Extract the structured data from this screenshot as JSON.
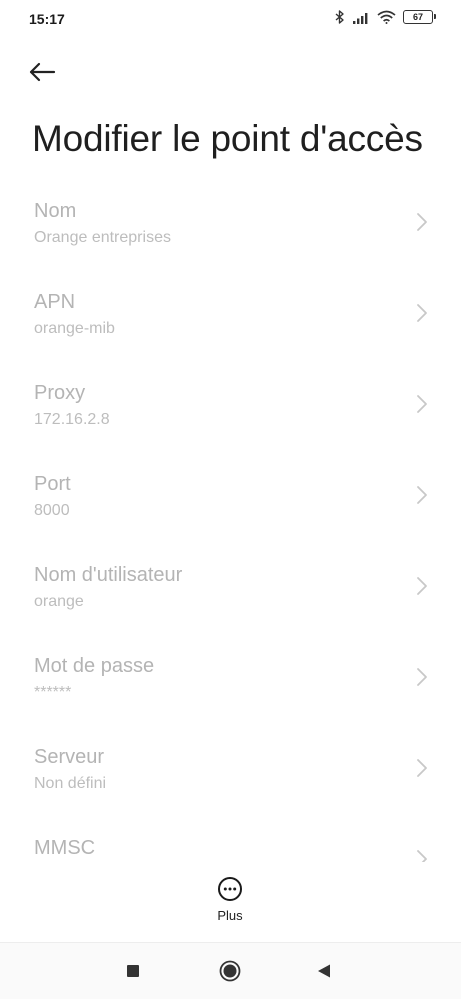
{
  "status_bar": {
    "time": "15:17",
    "battery_level": "67",
    "icons": [
      "bluetooth-icon",
      "signal-icon",
      "wifi-icon",
      "battery-icon"
    ]
  },
  "header": {
    "back_icon": "arrow-left-icon",
    "title": "Modifier le point d'accès"
  },
  "settings": {
    "items": [
      {
        "title": "Nom",
        "value": "Orange entreprises"
      },
      {
        "title": "APN",
        "value": "orange-mib"
      },
      {
        "title": "Proxy",
        "value": "172.16.2.8"
      },
      {
        "title": "Port",
        "value": "8000"
      },
      {
        "title": "Nom d'utilisateur",
        "value": "orange"
      },
      {
        "title": "Mot de passe",
        "value": "******"
      },
      {
        "title": "Serveur",
        "value": "Non défini"
      },
      {
        "title": "MMSC",
        "value": ""
      }
    ]
  },
  "footer": {
    "more_label": "Plus",
    "more_icon": "more-horizontal-icon"
  },
  "nav_bar": {
    "icons": [
      "recents-square-icon",
      "home-circle-icon",
      "back-triangle-icon"
    ]
  },
  "colors": {
    "text_primary": "#1f1f1f",
    "text_disabled": "#b4b4b4",
    "background": "#ffffff"
  }
}
